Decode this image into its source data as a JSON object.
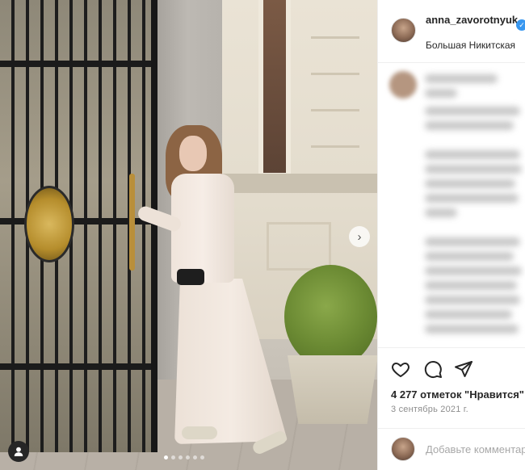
{
  "post": {
    "username": "anna_zavorotnyuk",
    "verified_badge": "✓",
    "location": "Большая Никитская",
    "likes_text": "4 277 отметок \"Нравится\"",
    "date_text": "3 сентябрь 2021 г.",
    "comment_placeholder": "Добавьте комментарий...",
    "carousel": {
      "slide_count": 6,
      "active_index": 0,
      "next_arrow": "›"
    }
  },
  "icons": {
    "like": "heart-icon",
    "comment": "comment-bubble-icon",
    "share": "paper-plane-icon",
    "next": "chevron-right-icon",
    "tag": "user-tag-icon",
    "verified": "verified-badge-icon"
  },
  "colors": {
    "verified_blue": "#3897f0",
    "text_primary": "#262626",
    "text_secondary": "#8e8e8e",
    "placeholder": "#a8a8a8",
    "divider": "#efefef"
  }
}
